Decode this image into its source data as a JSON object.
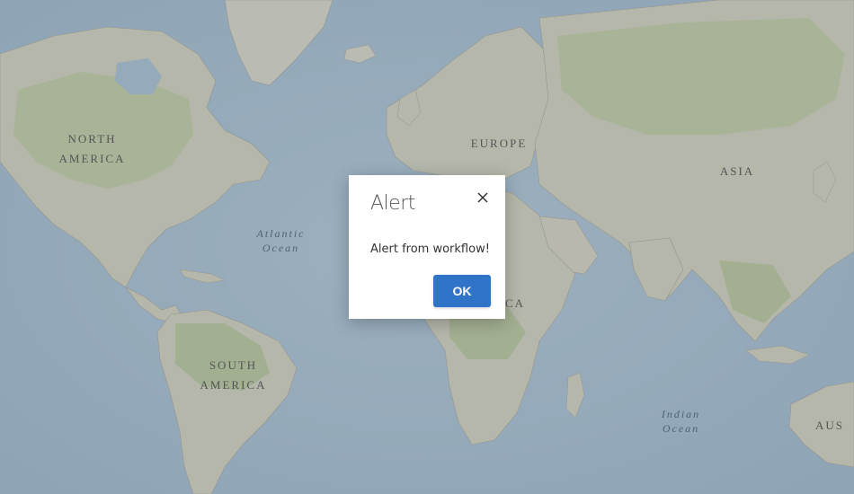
{
  "map": {
    "labels": {
      "north_america": "NORTH\nAMERICA",
      "europe": "EUROPE",
      "asia": "ASIA",
      "south_america": "SOUTH\nAMERICA",
      "africa_partial": "CA",
      "australia_partial": "AUS"
    },
    "oceans": {
      "atlantic": "Atlantic\nOcean",
      "indian": "Indian\nOcean"
    },
    "colors": {
      "ocean": "#a9c8e0",
      "land": "#d9dccb",
      "vegetation": "#b8cc9a",
      "overlay": "rgba(110,110,110,0.32)"
    }
  },
  "dialog": {
    "title": "Alert",
    "message": "Alert from workflow!",
    "ok_label": "OK",
    "close_icon": "close-icon",
    "accent": "#2f74c7"
  }
}
